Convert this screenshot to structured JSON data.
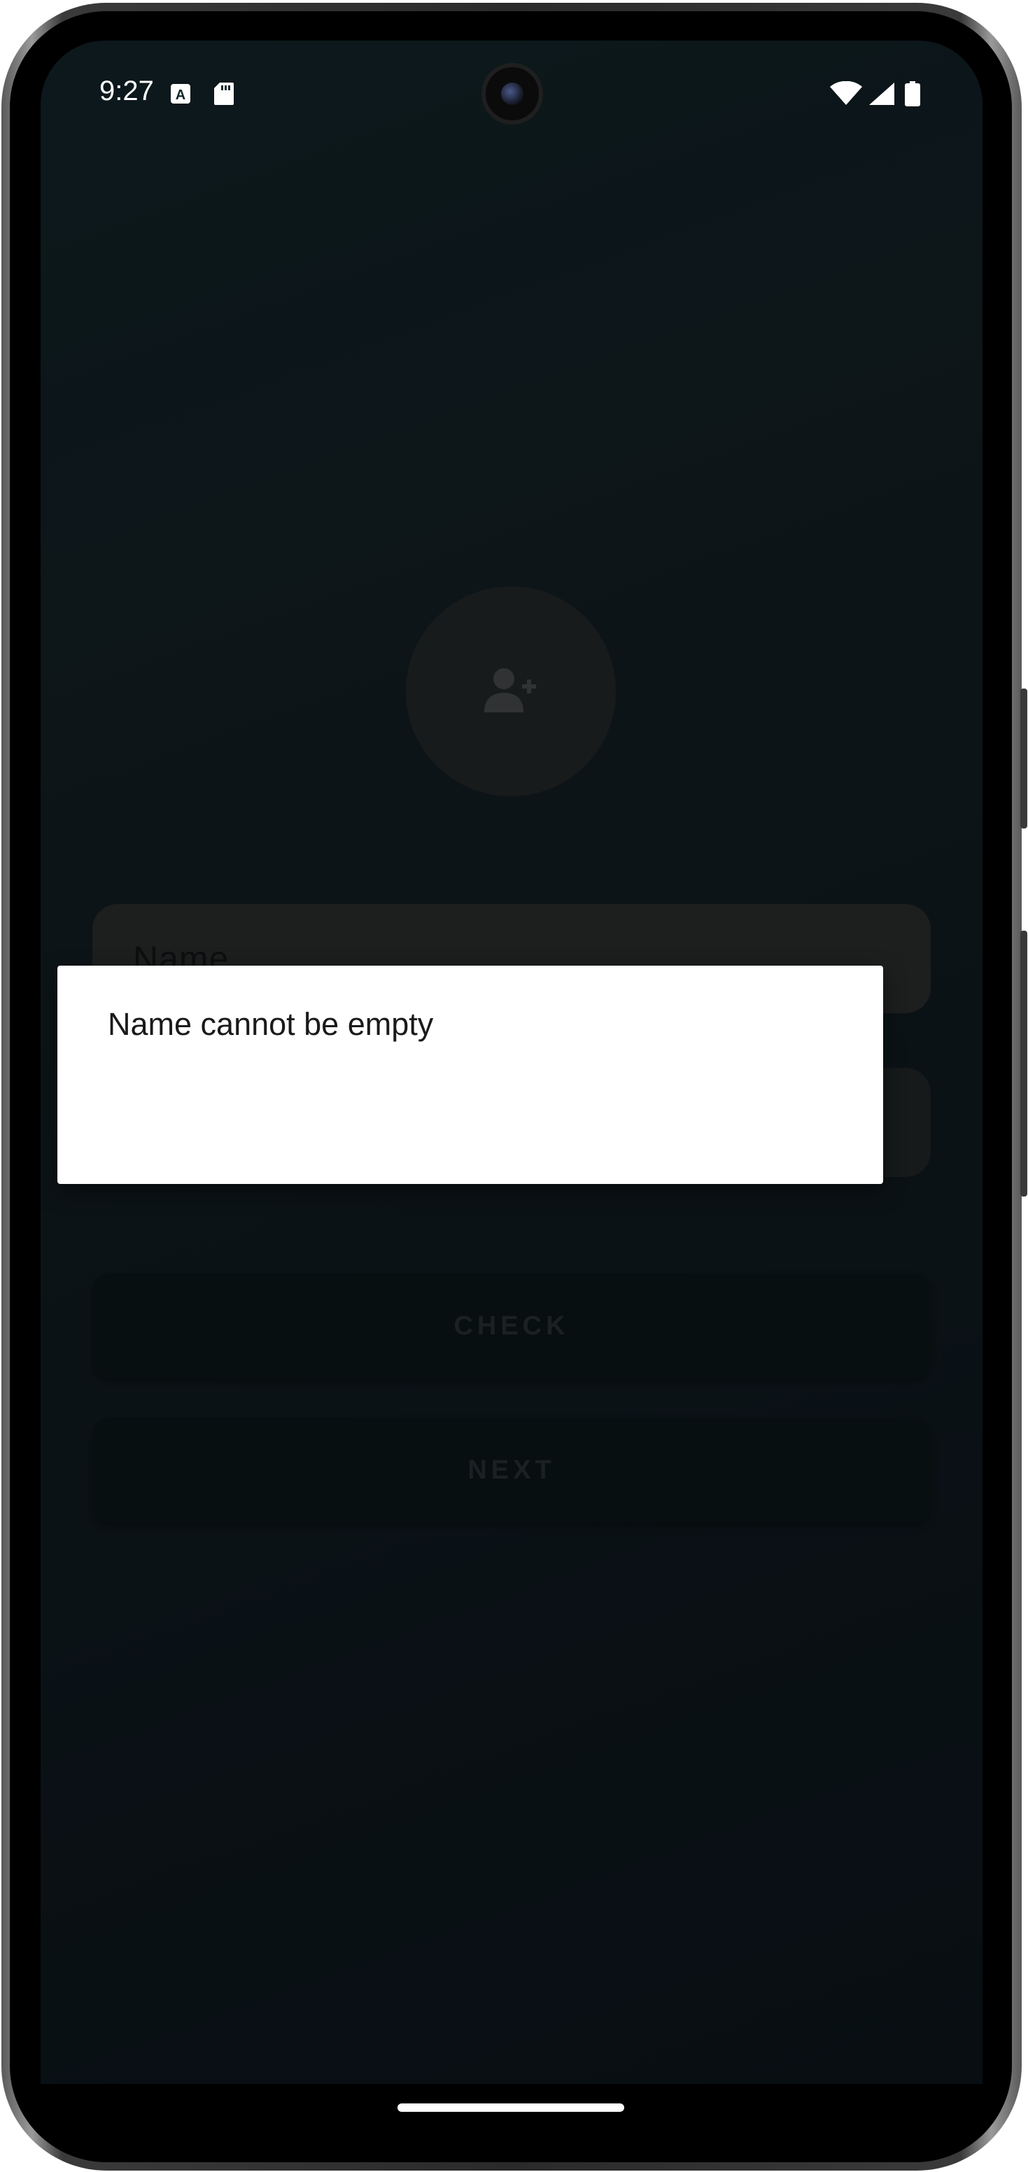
{
  "status_bar": {
    "time": "9:27",
    "icons": [
      "keyboard-a-icon",
      "sd-card-icon",
      "wifi-icon",
      "signal-icon",
      "battery-icon"
    ]
  },
  "form": {
    "avatar_icon": "add-person-icon",
    "name_placeholder": "Name",
    "check_label": "CHECK",
    "next_label": "NEXT"
  },
  "toast": {
    "message": "Name cannot be empty"
  },
  "colors": {
    "background": "#13232a",
    "toast_bg": "#ffffff",
    "button_bg": "#0c171b"
  }
}
